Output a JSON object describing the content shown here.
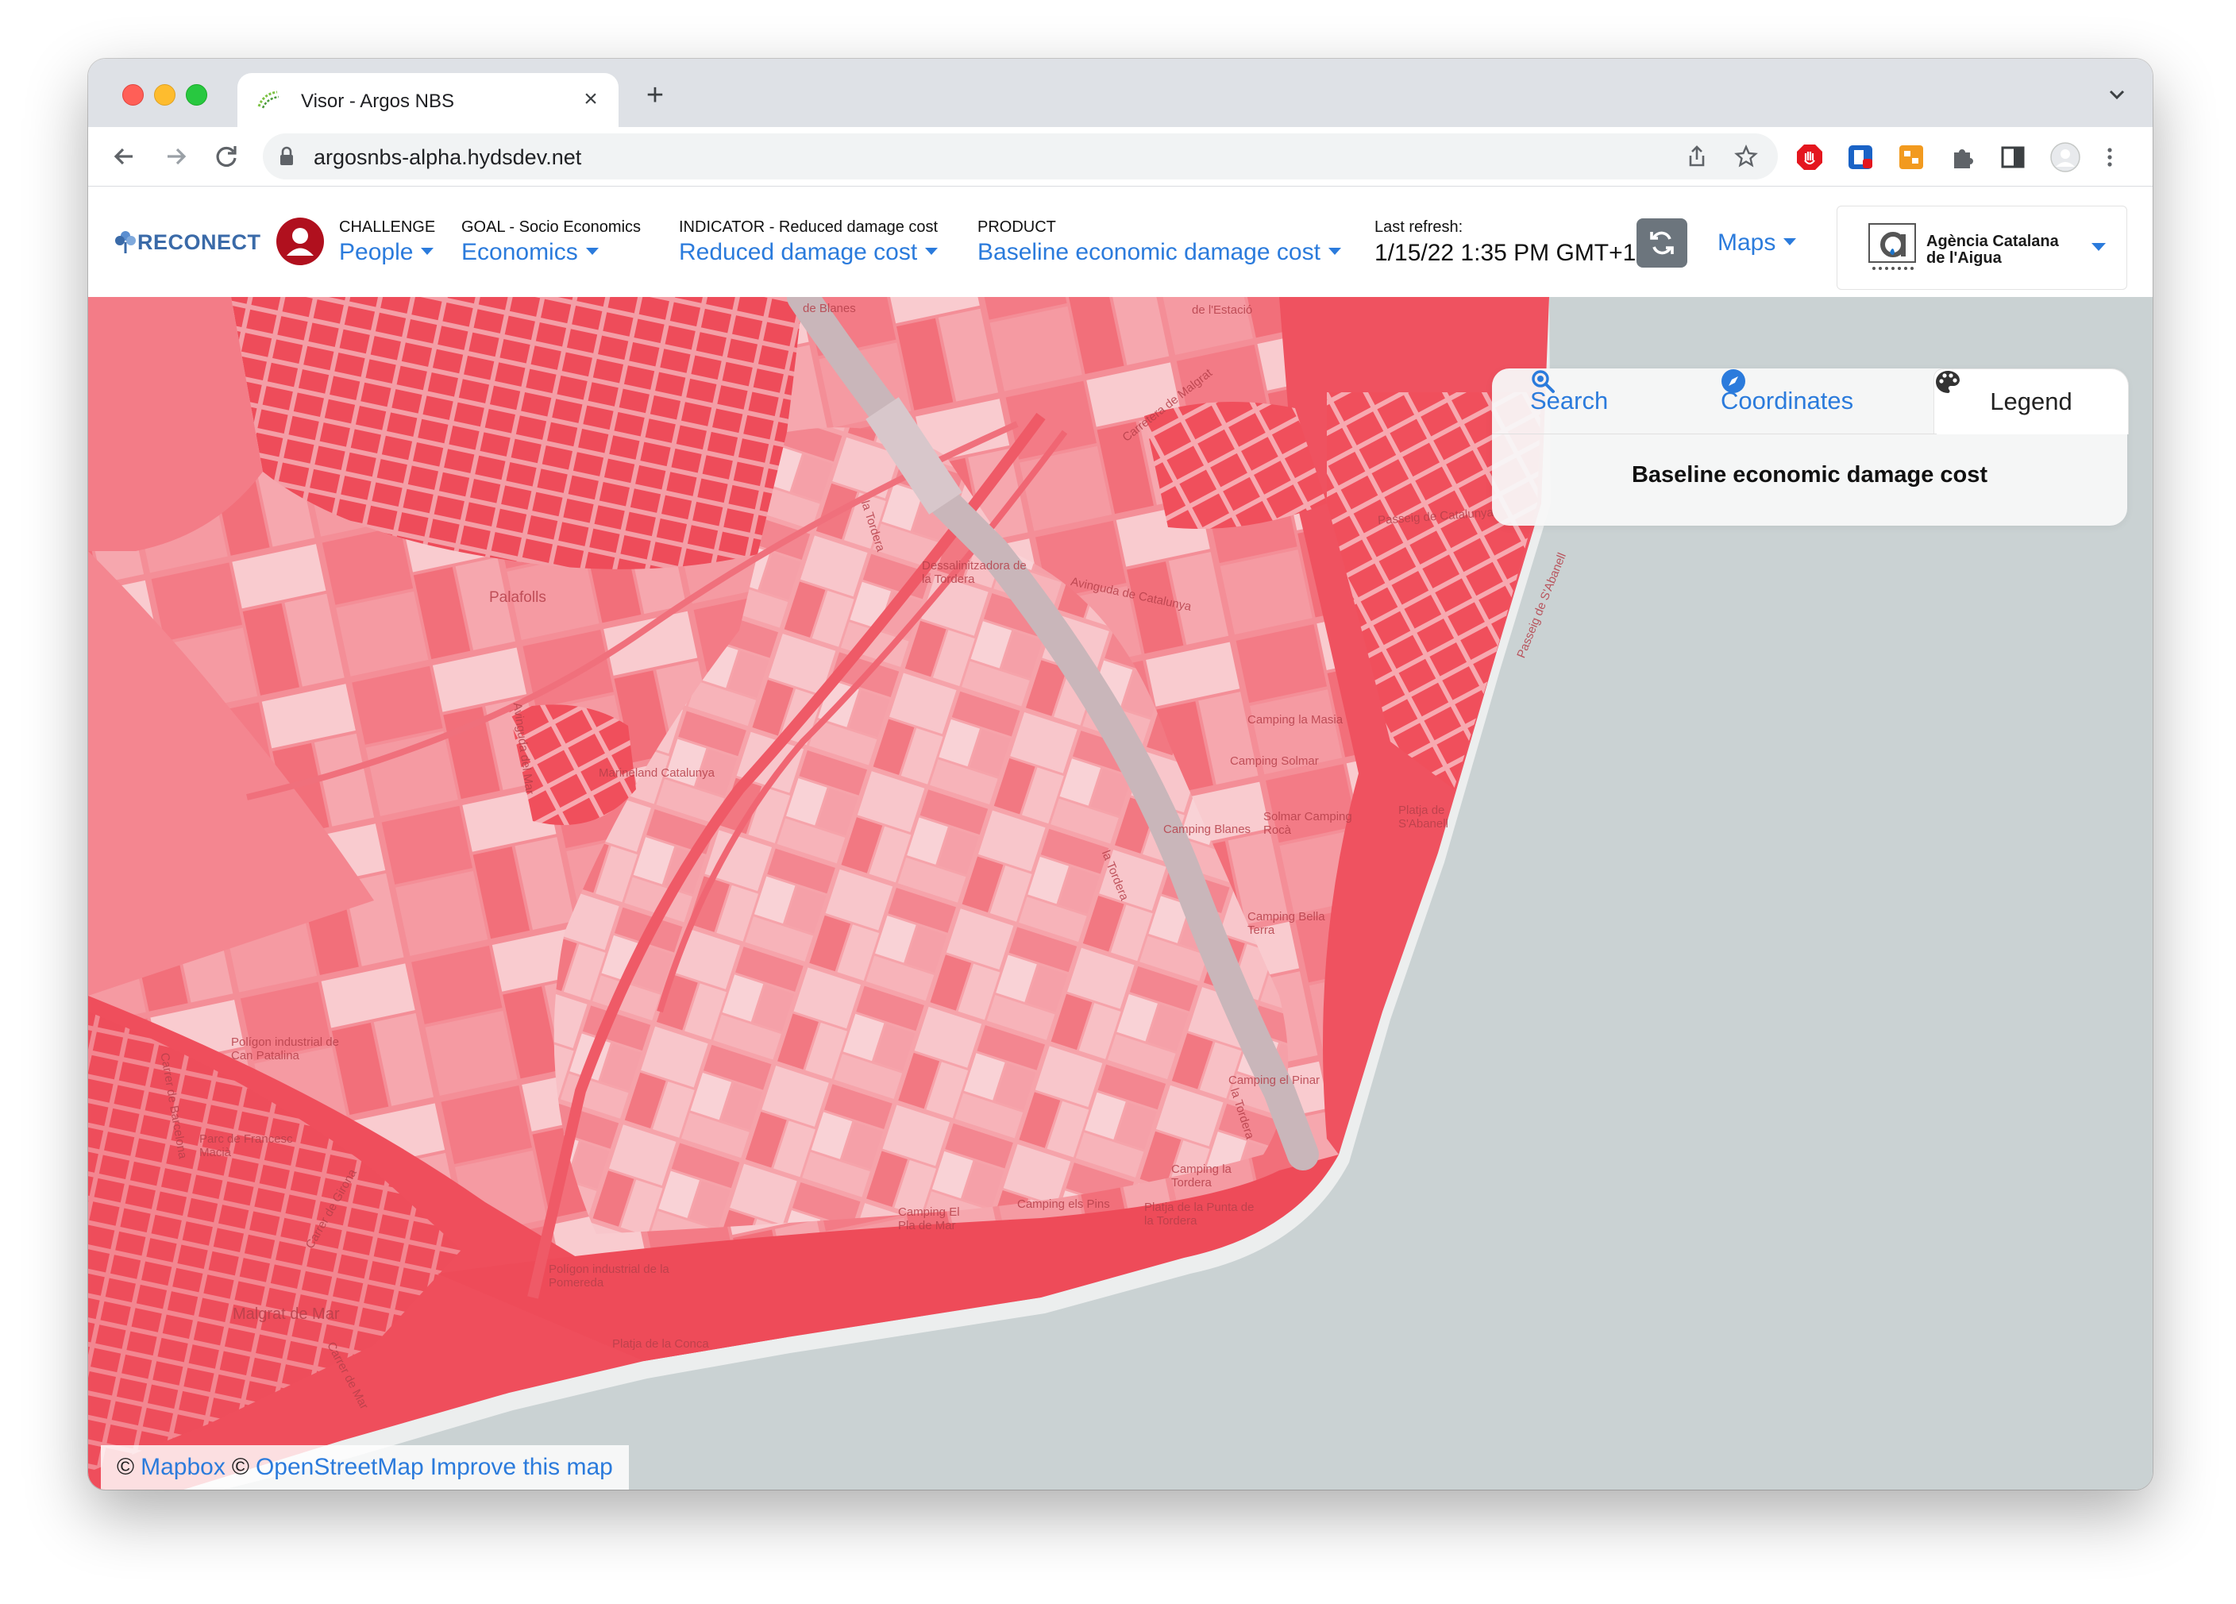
{
  "browser": {
    "tab_title": "Visor - Argos NBS",
    "url": "argosnbs-alpha.hydsdev.net"
  },
  "header": {
    "brand": "RECONECT",
    "challenge": {
      "label": "CHALLENGE",
      "value": "People"
    },
    "goal": {
      "label": "GOAL - Socio Economics",
      "value": "Economics"
    },
    "indicator": {
      "label": "INDICATOR - Reduced damage cost",
      "value": "Reduced damage cost"
    },
    "product": {
      "label": "PRODUCT",
      "value": "Baseline economic damage cost"
    },
    "refresh": {
      "label": "Last refresh:",
      "value": "1/15/22 1:35 PM GMT+1"
    },
    "maps_label": "Maps",
    "org": {
      "line1": "Agència Catalana",
      "line2": "de l'Aigua"
    }
  },
  "panel": {
    "tabs": [
      {
        "label": "Search",
        "icon": "search-icon"
      },
      {
        "label": "Coordinates",
        "icon": "compass-icon"
      },
      {
        "label": "Legend",
        "icon": "palette-icon"
      }
    ],
    "active_tab": "Legend",
    "title": "Baseline economic damage cost"
  },
  "attribution": {
    "symbol1": "©",
    "link1": "Mapbox",
    "symbol2": "©",
    "link2": "OpenStreetMap",
    "link3": "Improve this map"
  },
  "map_labels": [
    "Palafolls",
    "Marineland Catalunya",
    "Dessalinitzadora de la Tordera",
    "la Tordera",
    "la Tordera",
    "la Tordera",
    "Avinguda de Catalunya",
    "Camping la Masia",
    "Camping Solmar",
    "Solmar Camping Rocà",
    "Camping Blanes",
    "Camping Bella Terra",
    "Camping el Pinar",
    "Camping la Tordera",
    "Platja de S'Abanell",
    "Passeig de S'Abanell",
    "Camping els Pins",
    "Platja de la Punta de la Tordera",
    "Camping El Pla de Mar",
    "Polígon industrial de la Pomereda",
    "Platja de la Conca",
    "Malgrat de Mar",
    "Polígon industrial de Can Patalina",
    "Parc de Francesc Macià",
    "Carrer de Barcelona",
    "Passeig de Catalunya",
    "Carretera de Malgrat",
    "Carrer de Girona",
    "Carrer de Mar",
    "de Blanes",
    "de l'Estació",
    "Avinguda del Mar"
  ],
  "colors": {
    "accent": "#2b7bdc",
    "map_dark": "#f0505e",
    "map_mid": "#f48791",
    "map_light": "#f8c3c8",
    "sea": "#cad2d3",
    "river": "#c9b9bc"
  }
}
